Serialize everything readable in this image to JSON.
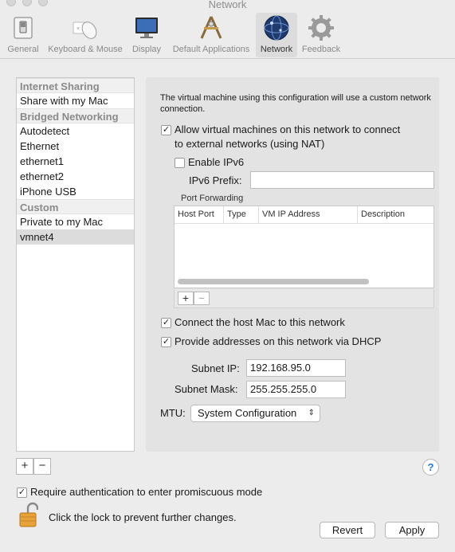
{
  "window": {
    "title": "Network"
  },
  "toolbar": {
    "items": [
      {
        "label": "General",
        "icon": "switch-icon"
      },
      {
        "label": "Keyboard & Mouse",
        "icon": "mouse-icon"
      },
      {
        "label": "Display",
        "icon": "monitor-icon"
      },
      {
        "label": "Default Applications",
        "icon": "applications-icon"
      },
      {
        "label": "Network",
        "icon": "globe-icon",
        "active": true
      },
      {
        "label": "Feedback",
        "icon": "gear-icon"
      }
    ]
  },
  "sidebar": {
    "rows": [
      {
        "label": "Internet Sharing",
        "header": true
      },
      {
        "label": "Share with my Mac"
      },
      {
        "label": "Bridged Networking",
        "header": true
      },
      {
        "label": "Autodetect"
      },
      {
        "label": "Ethernet"
      },
      {
        "label": "ethernet1"
      },
      {
        "label": "ethernet2"
      },
      {
        "label": "iPhone USB"
      },
      {
        "label": "Custom",
        "header": true
      },
      {
        "label": "Private to my Mac"
      },
      {
        "label": "vmnet4",
        "selected": true
      }
    ],
    "add_label": "+",
    "remove_label": "−"
  },
  "panel": {
    "intro": "The virtual machine using this configuration will use a custom network connection.",
    "nat_label_line1": "Allow virtual machines on this network to connect",
    "nat_label_line2": "to external networks (using NAT)",
    "nat_checked": true,
    "ipv6_label": "Enable IPv6",
    "ipv6_checked": false,
    "ipv6_prefix_label": "IPv6 Prefix:",
    "ipv6_prefix_value": "",
    "port_forwarding_label": "Port Forwarding",
    "pf_columns": [
      "Host Port",
      "Type",
      "VM IP Address",
      "Description"
    ],
    "pf_add": "+",
    "pf_remove": "−",
    "connect_host_label": "Connect the host Mac to this network",
    "connect_host_checked": true,
    "dhcp_label": "Provide addresses on this network via DHCP",
    "dhcp_checked": true,
    "subnet_ip_label": "Subnet IP:",
    "subnet_ip_value": "192.168.95.0",
    "subnet_mask_label": "Subnet Mask:",
    "subnet_mask_value": "255.255.255.0",
    "mtu_label": "MTU:",
    "mtu_value": "System Configuration"
  },
  "footer": {
    "help_label": "?",
    "promisc_label": "Require authentication to enter promiscuous mode",
    "promisc_checked": true,
    "lock_text": "Click the lock to prevent further changes.",
    "revert_label": "Revert",
    "apply_label": "Apply"
  },
  "colors": {
    "accent": "#1e7be0",
    "lock": "#e8a23a"
  }
}
